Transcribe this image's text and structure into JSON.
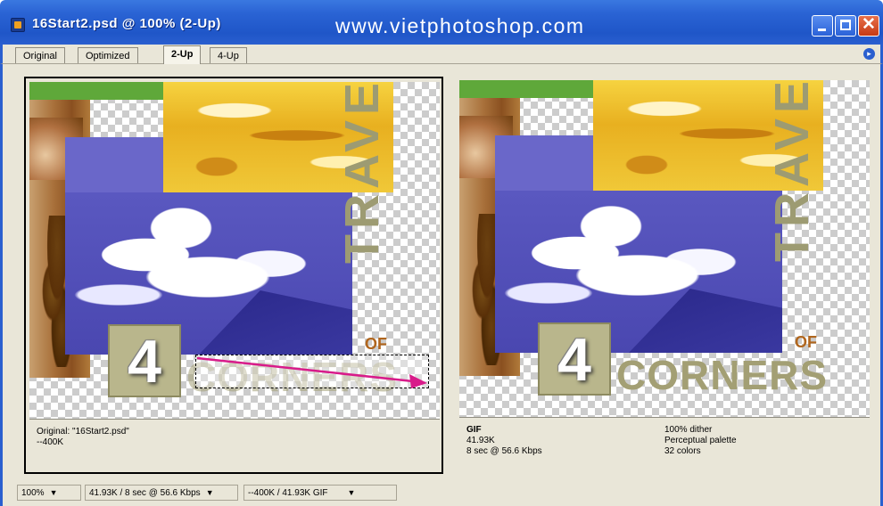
{
  "window": {
    "title": "16Start2.psd @ 100% (2-Up)",
    "watermark": "www.vietphotoshop.com",
    "close_glyph": "✕"
  },
  "tabs": [
    {
      "label": "Original",
      "active": false
    },
    {
      "label": "Optimized",
      "active": false
    },
    {
      "label": "2-Up",
      "active": true
    },
    {
      "label": "4-Up",
      "active": false
    }
  ],
  "artwork": {
    "number": "4",
    "of_text": "OF",
    "corners_text": "CORNERS",
    "travel_text": "TRAVEL"
  },
  "left_pane": {
    "info_line1": "Original: \"16Start2.psd\"",
    "info_line2": "--400K"
  },
  "right_pane": {
    "format": "GIF",
    "size": "41.93K",
    "time": "8 sec @ 56.6 Kbps",
    "dither": "100% dither",
    "palette": "Perceptual palette",
    "colors": "32 colors"
  },
  "statusbar": {
    "zoom": "100%",
    "size_time": "41.93K / 8 sec @ 56.6 Kbps",
    "compare": "--400K / 41.93K GIF"
  },
  "colors": {
    "title_bar": "#2a5fcf",
    "drag_arrow": "#d81b8a",
    "travel_text": "#9d9b72",
    "purple_photo": "#6a67c9",
    "yellow_photo": "#f0c030"
  },
  "icons": {
    "app": "photoshop-document-icon",
    "minimize": "minimize-icon",
    "maximize": "maximize-icon",
    "close": "close-icon",
    "dropdown": "chevron-down-icon",
    "palette_menu": "palette-menu-arrow-icon"
  }
}
